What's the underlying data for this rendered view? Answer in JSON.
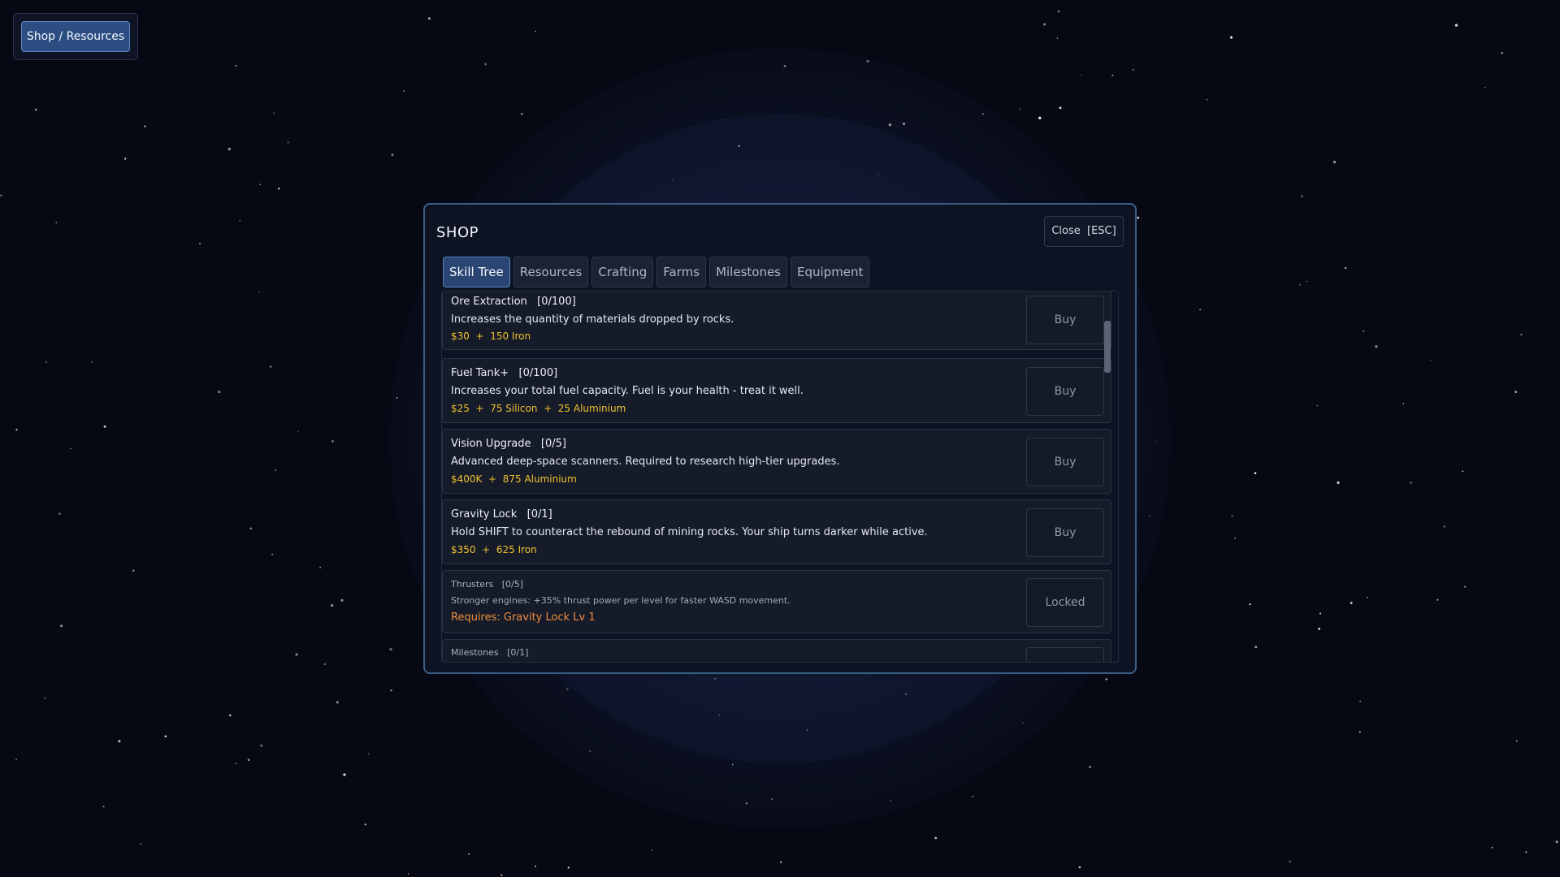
{
  "hud": {
    "shop_button_label": "Shop / Resources"
  },
  "shop": {
    "title": "SHOP",
    "close_label": "Close  [ESC]",
    "tabs": [
      {
        "label": "Skill Tree",
        "active": true
      },
      {
        "label": "Resources"
      },
      {
        "label": "Crafting"
      },
      {
        "label": "Farms"
      },
      {
        "label": "Milestones"
      },
      {
        "label": "Equipment"
      }
    ],
    "items": [
      {
        "name": "Ore Extraction   [0/100]",
        "description": "Increases the quantity of materials dropped by rocks.",
        "cost": "$30  +  150 Iron",
        "button": "Buy"
      },
      {
        "name": "Fuel Tank+   [0/100]",
        "description": "Increases your total fuel capacity. Fuel is your health - treat it well.",
        "cost": "$25  +  75 Silicon  +  25 Aluminium",
        "button": "Buy"
      },
      {
        "name": "Vision Upgrade   [0/5]",
        "description": "Advanced deep-space scanners. Required to research high-tier upgrades.",
        "cost": "$400K  +  875 Aluminium",
        "button": "Buy"
      },
      {
        "name": "Gravity Lock   [0/1]",
        "description": "Hold SHIFT to counteract the rebound of mining rocks. Your ship turns darker while active.",
        "cost": "$350  +  625 Iron",
        "button": "Buy"
      },
      {
        "name": "Thrusters   [0/5]",
        "description": "Stronger engines: +35% thrust power per level for faster WASD movement.",
        "cost": "Requires: Gravity Lock Lv 1",
        "button": "Locked"
      },
      {
        "name": "Milestones   [0/1]"
      }
    ]
  },
  "colors": {
    "accent": "#2b4d82",
    "panel_border": "#3a5e86",
    "cost": "#f2c230",
    "requirement": "#f08c3e"
  }
}
